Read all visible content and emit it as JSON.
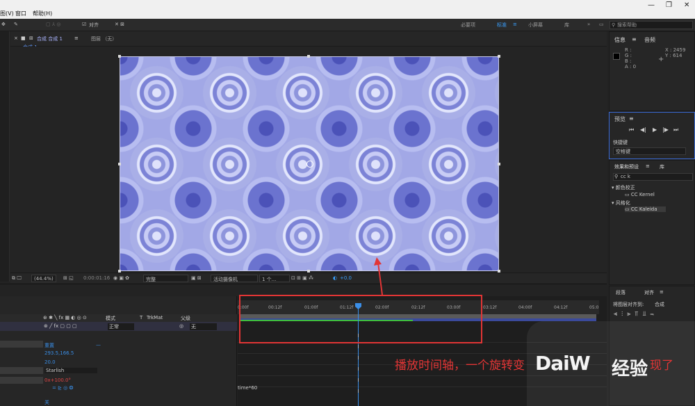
{
  "menubar": {
    "items": [
      "图(V)",
      "窗口",
      "帮助(H)"
    ]
  },
  "toolbar": {
    "align_label": "对齐",
    "workspaces": [
      "必要项",
      "标准",
      "小屏幕",
      "库"
    ],
    "search_placeholder": "搜索帮助"
  },
  "comp": {
    "tab_label": "合成 合成 1",
    "layer_label": "图层 （无）",
    "breadcrumb": "合成 1"
  },
  "viewer_bar": {
    "zoom": "(44.4%)",
    "timecode": "0:00:01:16",
    "quality": "完整",
    "camera": "活动摄像机",
    "views": "1 个...",
    "exposure": "+0.0"
  },
  "info_panel": {
    "tabs": [
      "信息",
      "音频"
    ],
    "rgb_labels": [
      "R :",
      "G :",
      "B :",
      "A : 0"
    ],
    "x": "X : 2459",
    "y": "Y : 614"
  },
  "preview_panel": {
    "title": "预览",
    "shortcut_label": "快捷键",
    "shortcut_value": "空格键"
  },
  "effects_panel": {
    "tabs": [
      "效果和预设",
      "库"
    ],
    "search_value": "cc k",
    "categories": [
      {
        "name": "颜色校正",
        "items": [
          "CC Kernel"
        ]
      },
      {
        "name": "风格化",
        "items": [
          "CC Kaleida"
        ]
      }
    ]
  },
  "align_panel": {
    "tabs": [
      "段落",
      "对齐"
    ],
    "align_to_label": "将图层对齐到:",
    "align_to_value": "合成"
  },
  "timeline": {
    "column_headers": {
      "mode": "模式",
      "t": "T",
      "trkmat": "TrkMat",
      "parent": "父级"
    },
    "layer_mode": "正常",
    "parent_value": "无",
    "ruler_ticks": [
      "0:00f",
      "00:12f",
      "01:00f",
      "01:12f",
      "02:00f",
      "02:12f",
      "03:00f",
      "03:12f",
      "04:00f",
      "04:12f",
      "05:0"
    ],
    "properties": {
      "reset": "重置",
      "center": "293.5,166.5",
      "size": "20.0",
      "shape": "Starlish",
      "rotation": "0x+100.0°",
      "expression": "time*60",
      "off": "关"
    }
  },
  "annotation": {
    "caption": "播放时间轴，一个旋转变",
    "caption_end": "现了"
  },
  "watermark": {
    "logo_text": "DaiW",
    "cn_text": "经验"
  }
}
